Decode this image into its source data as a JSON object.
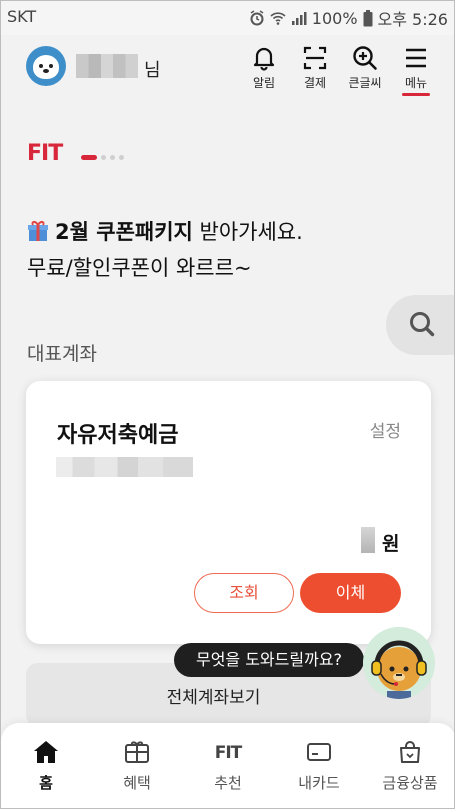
{
  "status_bar": {
    "carrier": "SKT",
    "battery": "100%",
    "time": "오후 5:26"
  },
  "header": {
    "name_suffix": "님",
    "actions": [
      {
        "label": "알림",
        "icon": "bell-icon"
      },
      {
        "label": "결제",
        "icon": "scan-icon"
      },
      {
        "label": "큰글씨",
        "icon": "zoom-in-icon"
      },
      {
        "label": "메뉴",
        "icon": "hamburger-icon"
      }
    ]
  },
  "banner": {
    "logo": "FIT",
    "line1_bold": "2월 쿠폰패키지",
    "line1_rest": " 받아가세요.",
    "line2": "무료/할인쿠폰이 와르르~",
    "page_count": 4,
    "active_page": 1
  },
  "account_section": {
    "title": "대표계좌",
    "account_name": "자유저축예금",
    "settings_label": "설정",
    "currency_unit": "원",
    "view_button": "조회",
    "transfer_button": "이체",
    "all_accounts": "전체계좌보기"
  },
  "help": {
    "bubble_text": "무엇을 도와드릴까요?"
  },
  "bottom_nav": {
    "items": [
      {
        "label": "홈",
        "icon": "home-icon",
        "active": true
      },
      {
        "label": "혜택",
        "icon": "gift-icon",
        "active": false
      },
      {
        "label": "추천",
        "icon": "fit-icon",
        "active": false
      },
      {
        "label": "내카드",
        "icon": "card-icon",
        "active": false
      },
      {
        "label": "금융상품",
        "icon": "shopping-bag-icon",
        "active": false
      }
    ],
    "fit_text": "FIT"
  },
  "colors": {
    "brand_red": "#d8263a",
    "accent_orange": "#ee4e30",
    "bubble_dark": "#1f1f1f"
  }
}
